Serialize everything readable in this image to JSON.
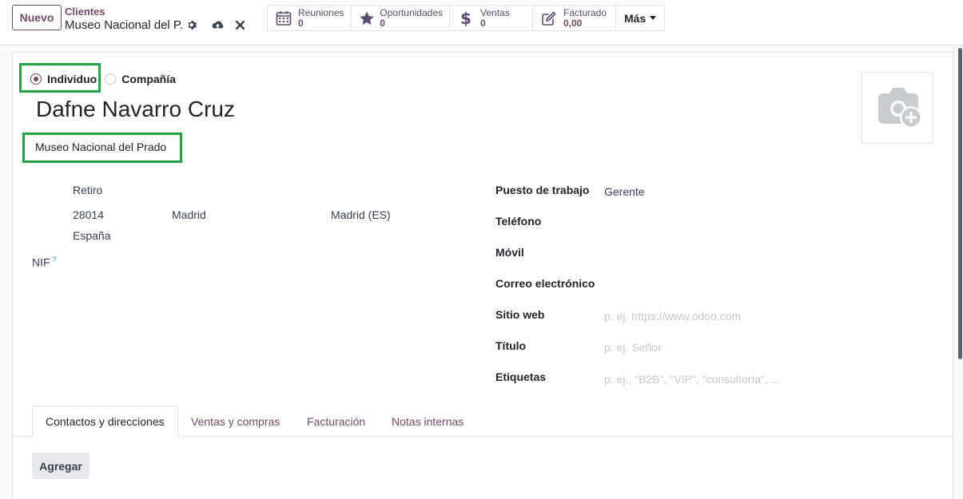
{
  "control_panel": {
    "new_label": "Nuevo",
    "breadcrumb_parent": "Clientes",
    "breadcrumb_current": "Museo Nacional del P..."
  },
  "smart_buttons": [
    {
      "label": "Reuniones",
      "value": "0",
      "icon": "calendar-icon"
    },
    {
      "label": "Oportunidades",
      "value": "0",
      "icon": "star-icon"
    },
    {
      "label": "Ventas",
      "value": "0",
      "icon": "dollar-icon"
    },
    {
      "label": "Facturado",
      "value": "0,00",
      "icon": "edit-invoice-icon"
    }
  ],
  "more_label": "Más",
  "company_type": {
    "individual_label": "Individuo",
    "company_label": "Compañía",
    "selected": "Individuo"
  },
  "partner": {
    "name": "Dafne Navarro Cruz",
    "company": "Museo Nacional del Prado"
  },
  "address": {
    "street": "Retiro",
    "zip": "28014",
    "city": "Madrid",
    "state": "Madrid (ES)",
    "country": "España"
  },
  "nif_label": "NIF",
  "nif_help": "?",
  "fields": {
    "job_label": "Puesto de trabajo",
    "job_value": "Gerente",
    "phone_label": "Teléfono",
    "mobile_label": "Móvil",
    "email_label": "Correo electrónico",
    "website_label": "Sitio web",
    "website_placeholder": "p. ej. https://www.odoo.com",
    "title_label": "Título",
    "title_placeholder": "p. ej. Señor",
    "tags_label": "Etiquetas",
    "tags_placeholder": "p. ej., \"B2B\", \"VIP\", \"consultoría\", ..."
  },
  "tabs": [
    {
      "label": "Contactos y direcciones",
      "active": true
    },
    {
      "label": "Ventas y compras",
      "active": false
    },
    {
      "label": "Facturación",
      "active": false
    },
    {
      "label": "Notas internas",
      "active": false
    }
  ],
  "add_label": "Agregar",
  "colors": {
    "brand": "#714b67",
    "highlight": "#22a447"
  }
}
